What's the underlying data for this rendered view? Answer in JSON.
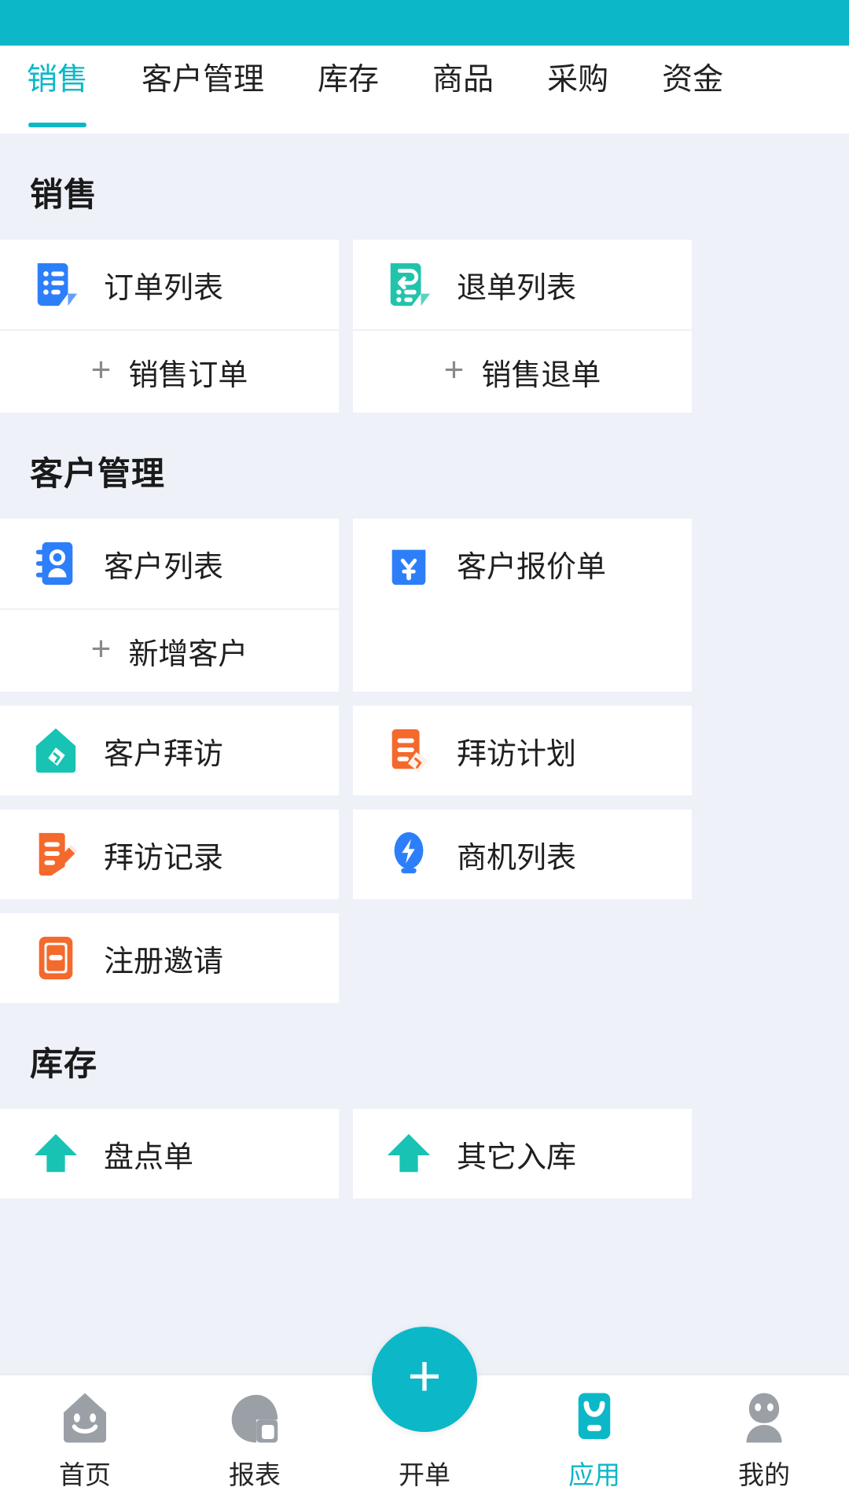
{
  "theme": {
    "accent": "#0cb8c7",
    "page_bg": "#eef1f8",
    "card_bg": "#ffffff",
    "text": "#1f1f1f",
    "muted": "#8a8a8e"
  },
  "tabs": [
    {
      "label": "销售",
      "active": true
    },
    {
      "label": "客户管理",
      "active": false
    },
    {
      "label": "库存",
      "active": false
    },
    {
      "label": "商品",
      "active": false
    },
    {
      "label": "采购",
      "active": false
    },
    {
      "label": "资金",
      "active": false
    }
  ],
  "sections": [
    {
      "title": "销售",
      "entries": [
        {
          "label": "订单列表",
          "icon": "order-list-icon",
          "icon_color": "#2d7ff9",
          "sub": {
            "label": "销售订单",
            "icon": "plus-icon"
          }
        },
        {
          "label": "退单列表",
          "icon": "return-list-icon",
          "icon_color": "#21c4ab",
          "sub": {
            "label": "销售退单",
            "icon": "plus-icon"
          }
        }
      ]
    },
    {
      "title": "客户管理",
      "entries": [
        {
          "label": "客户列表",
          "icon": "contact-book-icon",
          "icon_color": "#2d7ff9",
          "sub": {
            "label": "新增客户",
            "icon": "plus-icon"
          }
        },
        {
          "label": "客户报价单",
          "icon": "quotation-yuan-icon",
          "icon_color": "#2d7ff9",
          "sub": null
        },
        {
          "label": "客户拜访",
          "icon": "visit-house-icon",
          "icon_color": "#18c3b4",
          "sub": null
        },
        {
          "label": "拜访计划",
          "icon": "visit-plan-icon",
          "icon_color": "#f4692c",
          "sub": null
        },
        {
          "label": "拜访记录",
          "icon": "visit-record-icon",
          "icon_color": "#f4692c",
          "sub": null
        },
        {
          "label": "商机列表",
          "icon": "opportunity-bulb-icon",
          "icon_color": "#2d7ff9",
          "sub": null
        },
        {
          "label": "注册邀请",
          "icon": "register-invite-icon",
          "icon_color": "#f4692c",
          "sub": null
        }
      ]
    },
    {
      "title": "库存",
      "entries": [
        {
          "label": "盘点单",
          "icon": "stock-up-icon",
          "icon_color": "#18c3b4",
          "sub": null
        },
        {
          "label": "其它入库",
          "icon": "stock-up-icon",
          "icon_color": "#18c3b4",
          "sub": null
        }
      ]
    }
  ],
  "bottom_nav": [
    {
      "label": "首页",
      "icon": "home-smile-icon",
      "active": false,
      "fab": false
    },
    {
      "label": "报表",
      "icon": "report-chart-icon",
      "active": false,
      "fab": false
    },
    {
      "label": "开单",
      "icon": "plus-icon",
      "active": false,
      "fab": true
    },
    {
      "label": "应用",
      "icon": "apps-grid-icon",
      "active": true,
      "fab": false
    },
    {
      "label": "我的",
      "icon": "person-icon",
      "active": false,
      "fab": false
    }
  ]
}
